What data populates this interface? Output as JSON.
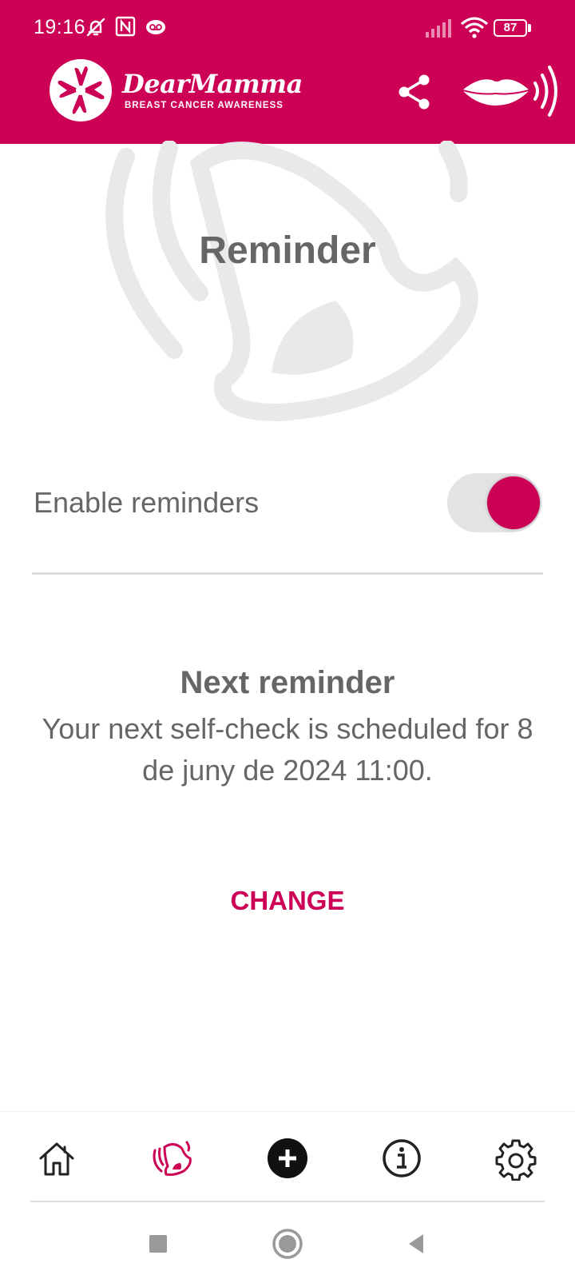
{
  "status_bar": {
    "time": "19:16",
    "battery": "87",
    "icons": [
      "mute-bell-icon",
      "nfc-icon",
      "voicemail-icon",
      "signal-icon",
      "wifi-icon",
      "battery-icon"
    ]
  },
  "header": {
    "app_name": "DearMamma",
    "tagline": "BREAST CANCER AWARENESS",
    "icons": [
      "share-icon",
      "speak-lips-icon"
    ]
  },
  "page": {
    "title": "Reminder"
  },
  "settings": {
    "enable_label": "Enable reminders",
    "enabled": true
  },
  "next_reminder": {
    "title": "Next reminder",
    "text": "Your next self-check is scheduled for 8 de juny de 2024 11:00."
  },
  "actions": {
    "change_label": "CHANGE"
  },
  "bottom_nav": {
    "items": [
      "home-icon",
      "reminder-icon",
      "add-icon",
      "info-icon",
      "settings-icon"
    ],
    "active": "reminder-icon"
  },
  "colors": {
    "brand": "#CC0055",
    "text_gray": "#666666",
    "toggle_track": "#E3E3E3"
  }
}
